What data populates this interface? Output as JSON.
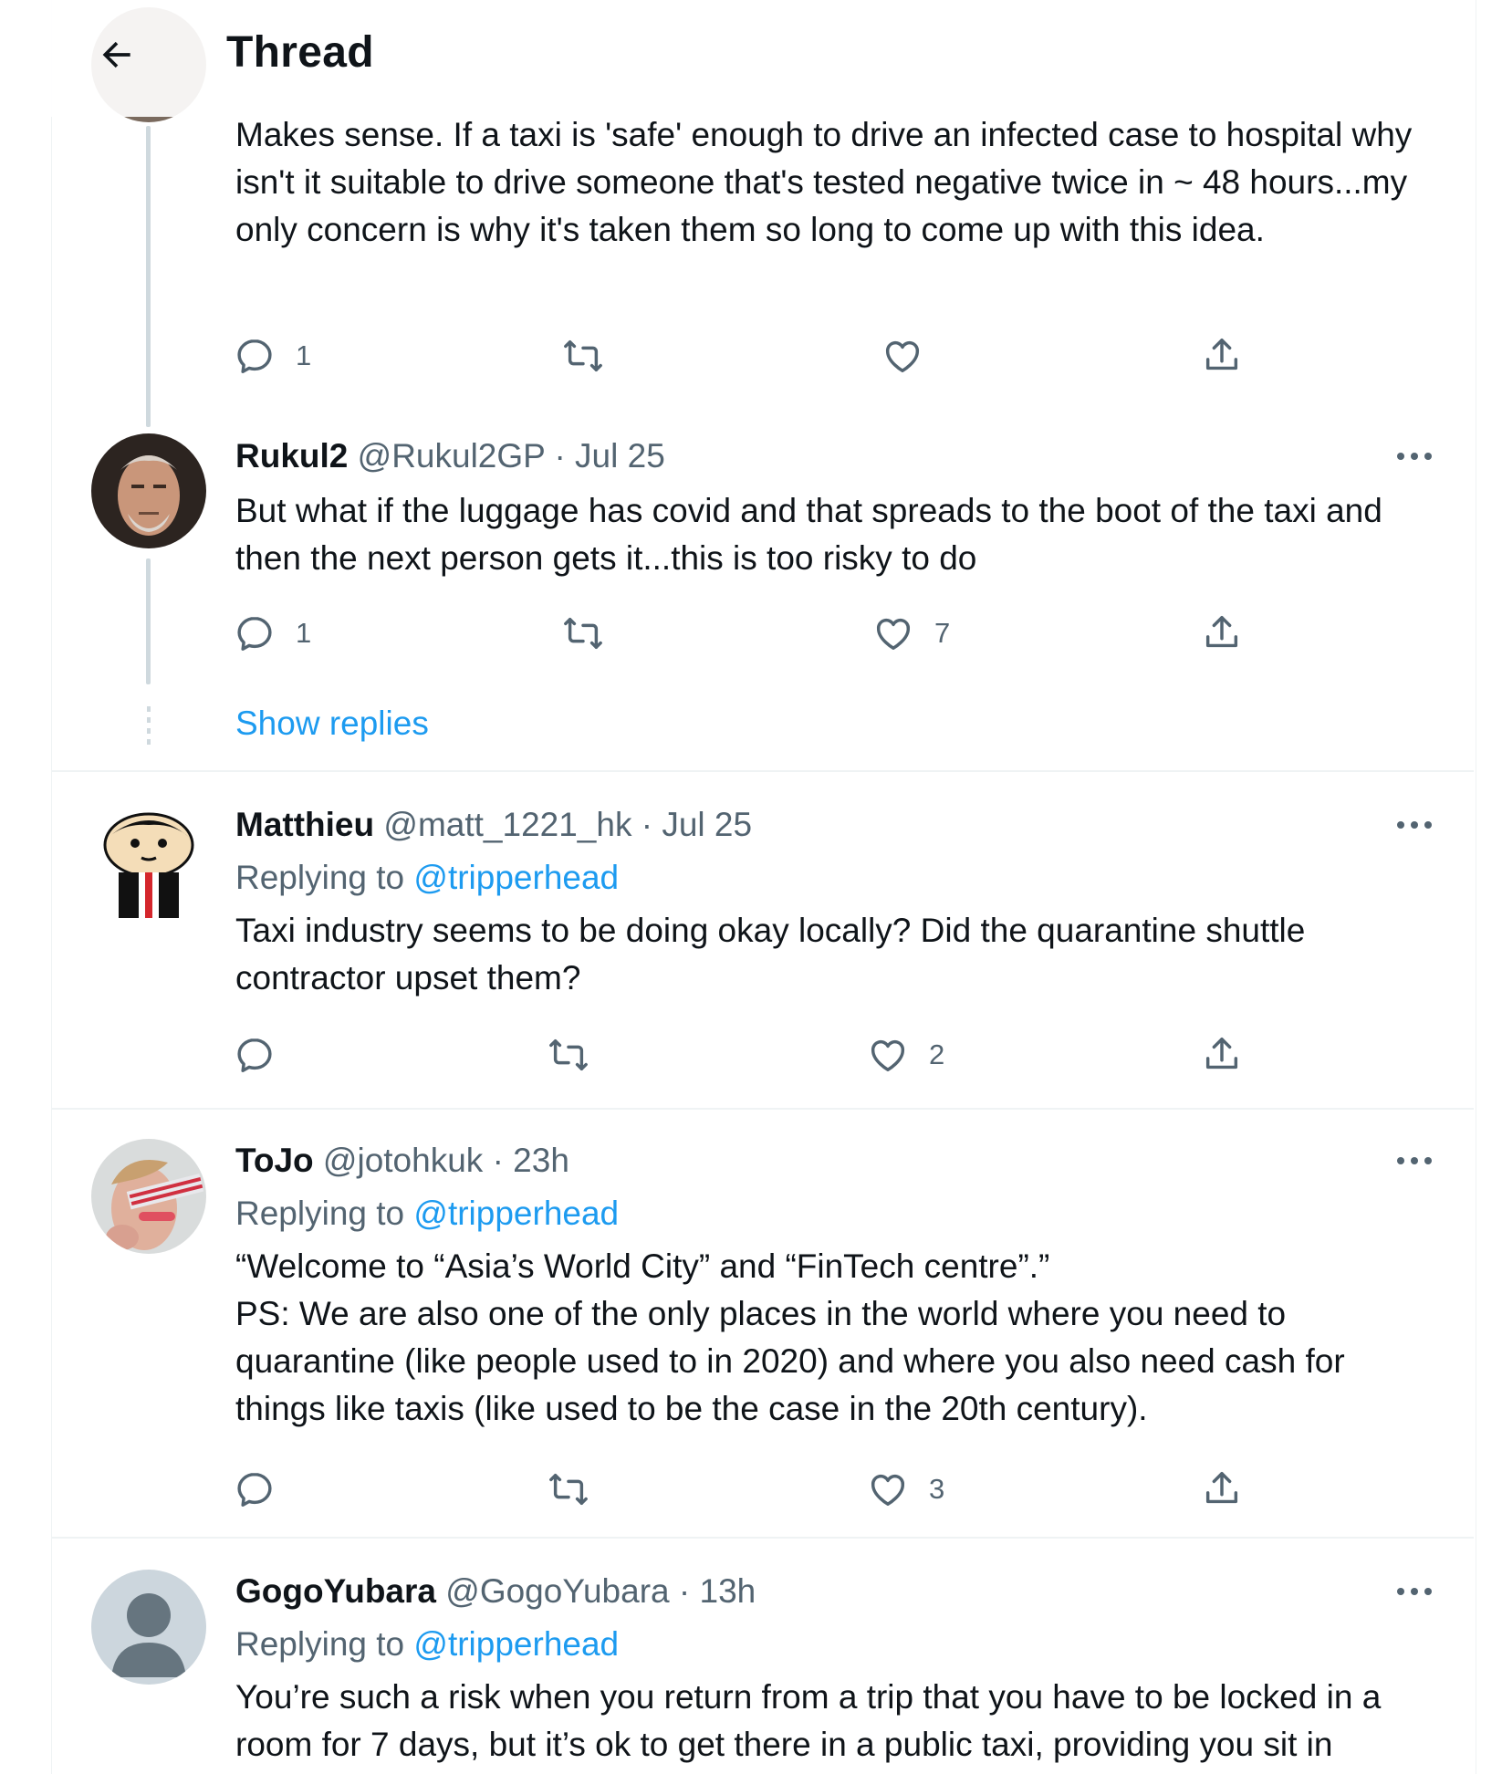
{
  "header": {
    "title": "Thread"
  },
  "tweet1": {
    "text": "Makes sense. If a taxi is 'safe' enough to drive an infected case to hospital why isn't it suitable to drive someone that's tested negative twice in ~ 48 hours...my only concern is why it's taken them so long to come up with this idea.",
    "reply_count": "1",
    "retweet_count": "",
    "like_count": "",
    "icons": [
      "reply-icon",
      "retweet-icon",
      "like-icon",
      "share-icon"
    ]
  },
  "tweet2": {
    "name": "Rukul2",
    "meta": "@Rukul2GP · Jul 25",
    "text": "But what if the luggage has covid and that spreads to the boot of the taxi and then the next person gets it...this is too risky to do",
    "reply_count": "1",
    "like_count": "7",
    "show_replies": "Show replies"
  },
  "tweet3": {
    "name": "Matthieu",
    "meta": "@matt_1221_hk · Jul 25",
    "replying_prefix": "Replying to ",
    "replying_to": "@tripperhead",
    "text": "Taxi industry seems to be doing okay locally? Did the quarantine shuttle contractor upset them?",
    "like_count": "2"
  },
  "tweet4": {
    "name": "ToJo",
    "meta": "@jotohkuk · 23h",
    "replying_prefix": "Replying to ",
    "replying_to": "@tripperhead",
    "text": "“Welcome to “Asia’s World City” and “FinTech centre”.”\nPS: We are also one of the only places in the world where you need to quarantine (like people used to in 2020) and where you also need cash for things like taxis (like used to be the case in the 20th century).",
    "like_count": "3"
  },
  "tweet5": {
    "name": "GogoYubara",
    "meta": "@GogoYubara · 13h",
    "replying_prefix": "Replying to ",
    "replying_to": "@tripperhead",
    "text": "You’re such a risk when you return from a trip that you have to be locked in a room for 7 days, but it’s ok to get there in a public taxi, providing you sit in"
  },
  "colors": {
    "link": "#1d9bf0",
    "secondary": "#536471",
    "thread_line": "#cfd9de",
    "divider": "#eff3f4"
  }
}
